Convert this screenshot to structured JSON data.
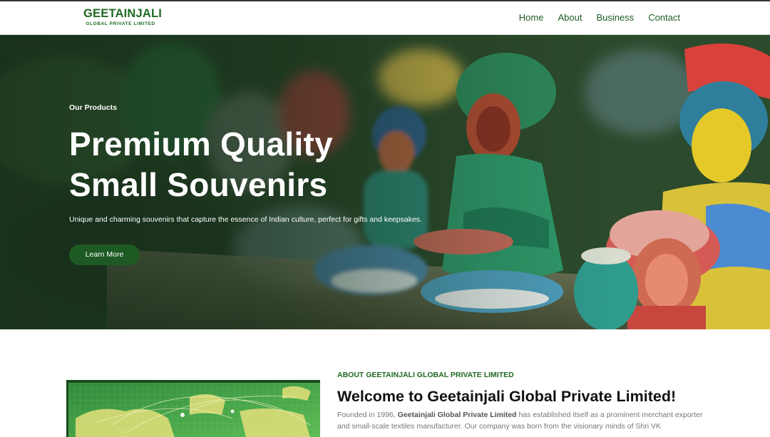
{
  "header": {
    "logo_main": "GEETAINJALI",
    "logo_sub": "GLOBAL PRIVATE LIMITED",
    "nav": [
      {
        "label": "Home"
      },
      {
        "label": "About"
      },
      {
        "label": "Business"
      },
      {
        "label": "Contact"
      }
    ]
  },
  "hero": {
    "eyebrow": "Our Products",
    "title_line1": "Premium Quality",
    "title_line2": "Small Souvenirs",
    "description": "Unique and charming souvenirs that capture the essence of Indian culture, perfect for gifts and keepsakes.",
    "button_label": "Learn More"
  },
  "about": {
    "eyebrow": "ABOUT GEETAINJALI GLOBAL PRIVATE LIMITED",
    "title": "Welcome to Geetainjali Global Private Limited!",
    "text_before": "Founded in 1996,",
    "text_bold": "Geetainjali Global Private Limited",
    "text_after": "has established itself as a prominent merchant exporter and small-scale textiles manufacturer. Our company was born from the visionary minds of Shri VK"
  },
  "colors": {
    "brand_green": "#1f6a23",
    "button_green": "#1e5a23",
    "header_border": "#2f3a33"
  }
}
